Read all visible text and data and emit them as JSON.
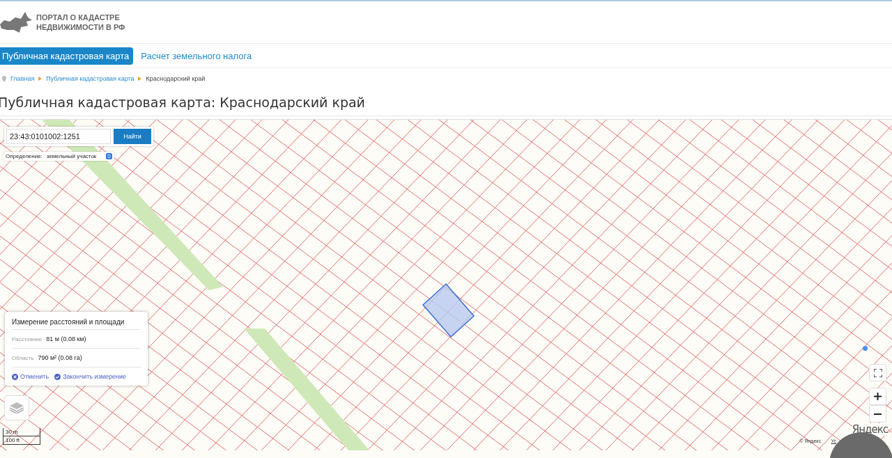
{
  "logo": {
    "line1": "ПОРТАЛ О КАДАСТРЕ",
    "line2": "НЕДВИЖИМОСТИ В РФ"
  },
  "nav": [
    {
      "label": "Публичная кадастровая карта",
      "selected": true
    },
    {
      "label": "Расчет земельного налога",
      "selected": false
    }
  ],
  "breadcrumbs": [
    {
      "label": "Главная",
      "kind": "link"
    },
    {
      "label": "Публичная кадастровая карта",
      "kind": "link"
    },
    {
      "label": "Краснодарский край",
      "kind": "current"
    }
  ],
  "title": "Публичная кадастровая карта: Краснодарский край",
  "map": {
    "search": {
      "value": "23:43:0101002:1251",
      "button": "Найти"
    },
    "definition": {
      "label": "Определение:",
      "value": "земельный участок"
    },
    "measure": {
      "title": "Измерение расстояний и площади",
      "rows": [
        {
          "label": "Расстояние",
          "value": "81 м (0.08 км)"
        },
        {
          "label": "Область",
          "value": "790 м² (0.08 га)"
        }
      ],
      "actions": [
        "Отменить",
        "Закончить измерение"
      ]
    },
    "scale": [
      "30 m",
      "100 ft"
    ],
    "brand": "Яндекс",
    "copyright": "© Яндекс",
    "terms": "Ус"
  }
}
